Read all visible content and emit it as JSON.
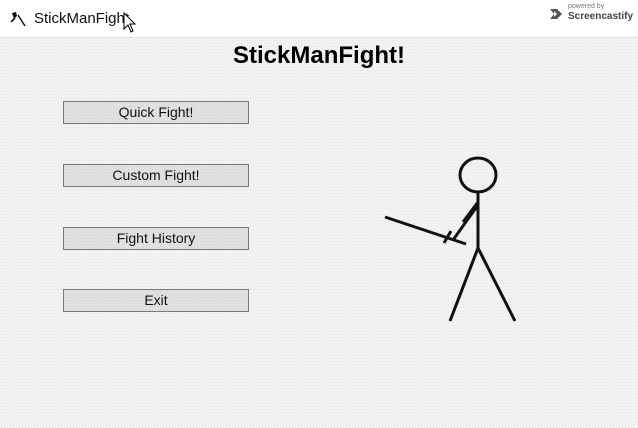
{
  "window": {
    "title": "StickManFight"
  },
  "watermark": {
    "small_text": "powered by",
    "name": "Screencastify"
  },
  "main": {
    "heading": "StickManFight!",
    "buttons": [
      {
        "label": "Quick Fight!"
      },
      {
        "label": "Custom Fight!"
      },
      {
        "label": "Fight History"
      },
      {
        "label": "Exit"
      }
    ]
  },
  "icons": {
    "app": "sword-icon",
    "cursor": "mouse-cursor-icon",
    "watermark": "screencastify-logo-icon",
    "figure": "stickman-with-sword"
  }
}
